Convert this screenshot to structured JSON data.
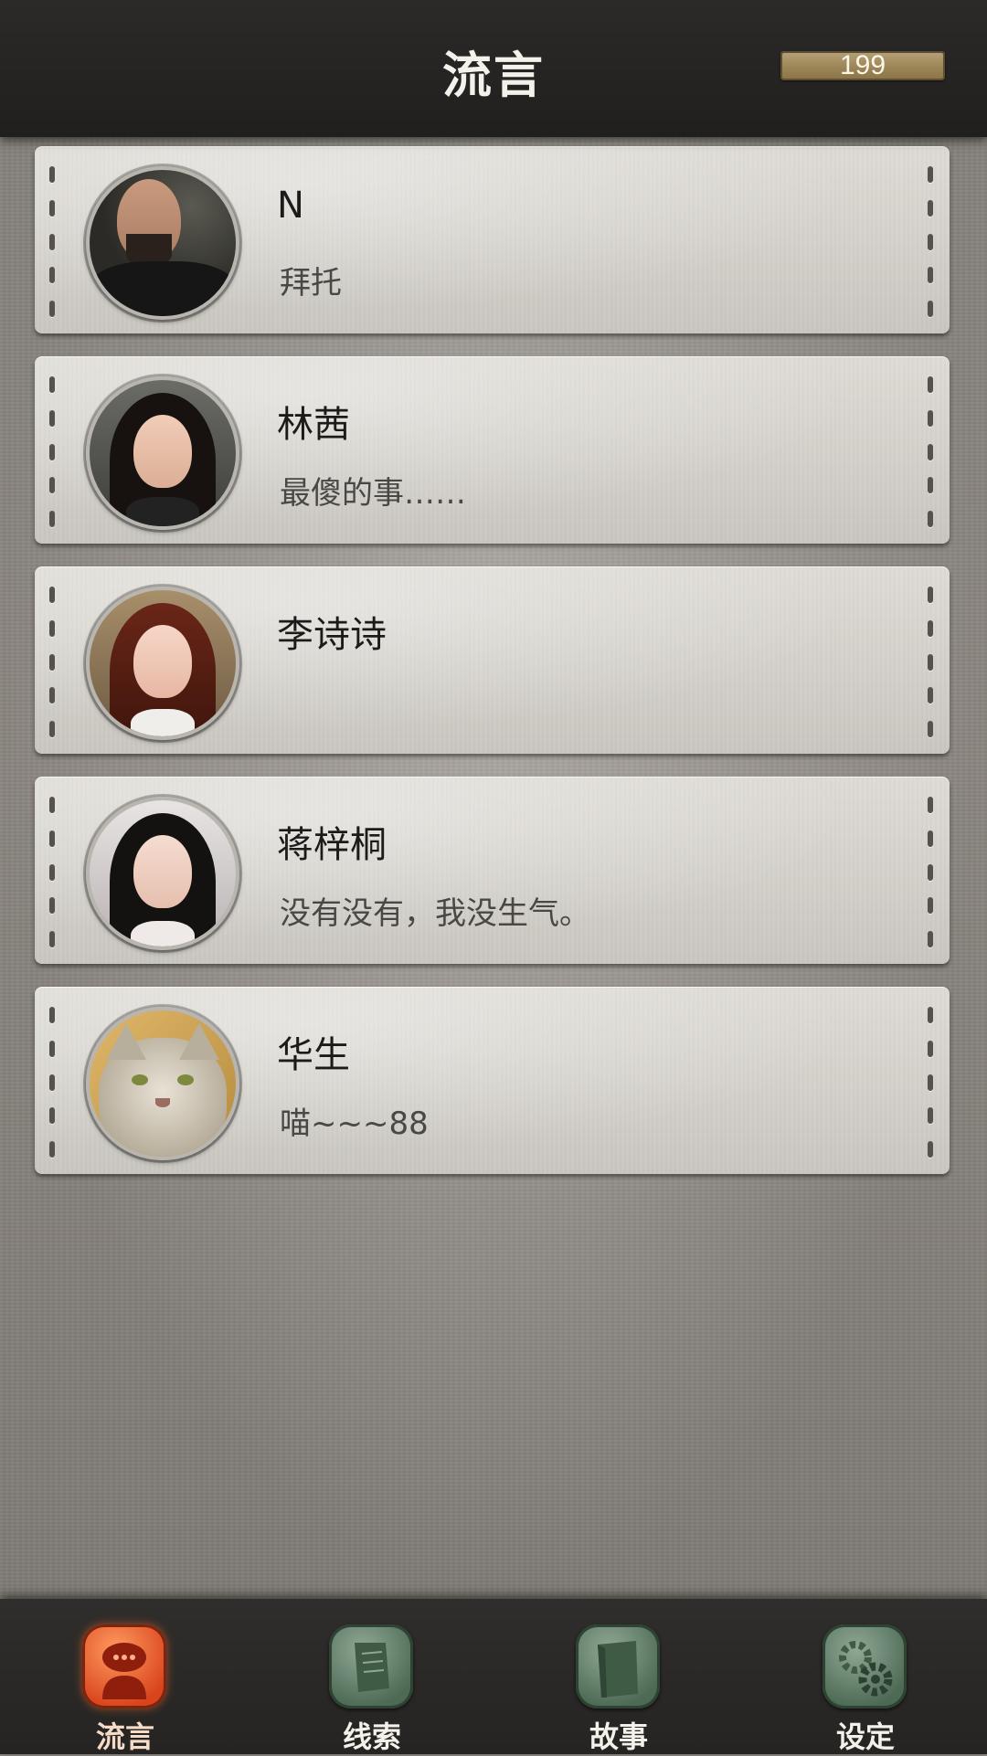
{
  "header": {
    "title": "流言",
    "coins": "199"
  },
  "conversations": [
    {
      "name": "N",
      "message": "拜托",
      "avatar": "man-avatar"
    },
    {
      "name": "林茜",
      "message": "最傻的事……",
      "avatar": "woman-avatar"
    },
    {
      "name": "李诗诗",
      "message": "",
      "avatar": "woman-avatar"
    },
    {
      "name": "蒋梓桐",
      "message": "没有没有，我没生气。",
      "avatar": "woman-avatar"
    },
    {
      "name": "华生",
      "message": "喵~~~88",
      "avatar": "cat-avatar"
    }
  ],
  "bottom_nav": {
    "items": [
      {
        "label": "流言",
        "icon": "chat-bubble-icon",
        "active": true
      },
      {
        "label": "线索",
        "icon": "scroll-icon",
        "active": false
      },
      {
        "label": "故事",
        "icon": "book-icon",
        "active": false
      },
      {
        "label": "设定",
        "icon": "gear-icon",
        "active": false
      }
    ]
  },
  "colors": {
    "accent_active": "#e8541f",
    "nav_inactive": "#5f7d67",
    "coin_bar": "#a48c5e"
  }
}
